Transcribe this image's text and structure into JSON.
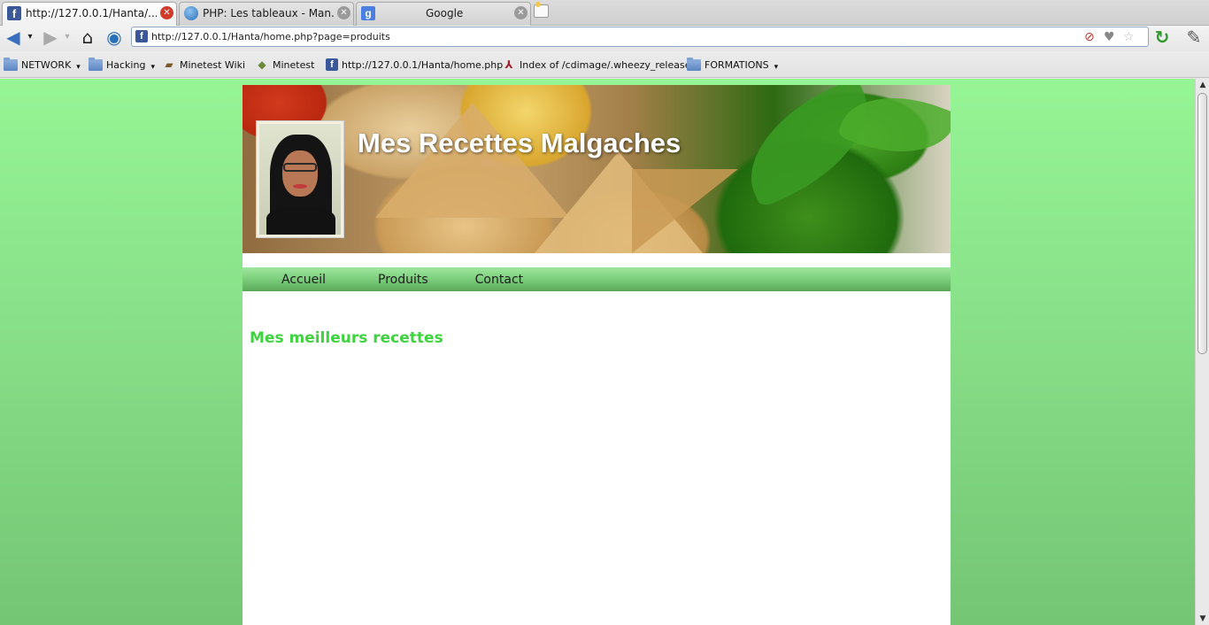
{
  "browser": {
    "tabs": [
      {
        "title": "http://127.0.0.1/Hanta/...",
        "favicon": "facebook-icon",
        "active": true
      },
      {
        "title": "PHP: Les tableaux - Man...",
        "favicon": "globe-icon",
        "active": false
      },
      {
        "title": "Google",
        "favicon": "google-icon",
        "active": false
      }
    ],
    "url": "http://127.0.0.1/Hanta/home.php?page=produits",
    "bookmarks": [
      {
        "label": "NETWORK",
        "icon": "folder-icon",
        "has_menu": true
      },
      {
        "label": "Hacking",
        "icon": "folder-icon",
        "has_menu": true
      },
      {
        "label": "Minetest Wiki",
        "icon": "book-icon",
        "has_menu": false
      },
      {
        "label": "Minetest",
        "icon": "minetest-icon",
        "has_menu": false
      },
      {
        "label": "http://127.0.0.1/Hanta/home.php",
        "icon": "facebook-icon",
        "has_menu": false
      },
      {
        "label": "Index of /cdimage/.wheezy_release",
        "icon": "debian-icon",
        "has_menu": false
      },
      {
        "label": "FORMATIONS",
        "icon": "folder-icon",
        "has_menu": true
      }
    ]
  },
  "site": {
    "title": "Mes Recettes Malgaches",
    "menu": [
      "Accueil",
      "Produits",
      "Contact"
    ],
    "section_heading": "Mes meilleurs recettes"
  },
  "colors": {
    "page_bg_top": "#96f595",
    "page_bg_bottom": "#74c574",
    "heading": "#3fd33f",
    "menu_bar": "#7bcd7b"
  }
}
